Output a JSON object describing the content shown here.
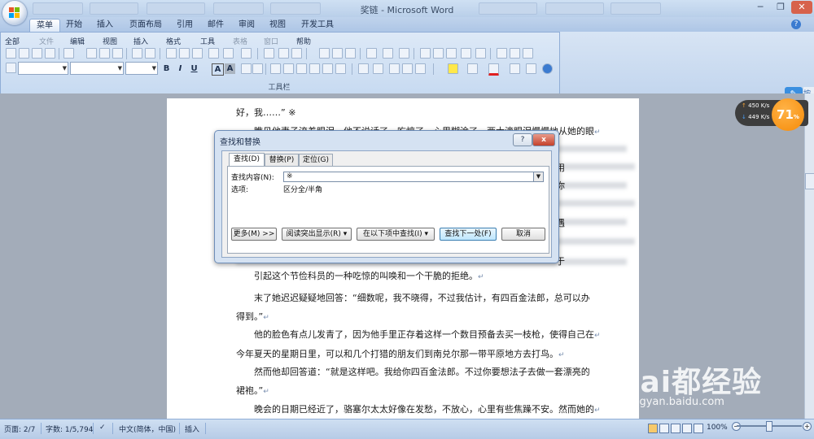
{
  "window": {
    "title": "奖链 - Microsoft Word",
    "background_tabs": [
      "",
      "",
      "",
      "",
      ""
    ]
  },
  "ribbon": {
    "tabs": [
      "菜单",
      "开始",
      "插入",
      "页面布局",
      "引用",
      "邮件",
      "审阅",
      "视图",
      "开发工具"
    ],
    "active_tab": "菜单",
    "menu_items": [
      "全部",
      "文件",
      "编辑",
      "视图",
      "插入",
      "格式",
      "工具",
      "表格",
      "窗口",
      "帮助"
    ],
    "disabled_menu_items": [
      "文件",
      "表格",
      "窗口"
    ],
    "toolbar_label": "工具栏",
    "format_buttons": [
      "B",
      "I",
      "U",
      "A",
      "A"
    ]
  },
  "document": {
    "lines": [
      {
        "indent": 85,
        "text": "好，我……” ※",
        "mark": ""
      },
      {
        "indent": 107,
        "text": "瞧见他妻子流着眼泪，他不说话了，吃惊了，心里糊涂了。两大滴眼泪慢慢地从她的眼",
        "mark": "↵"
      },
      {
        "indent": 107,
        "text": "引起这个节俭科员的一种吃惊的叫唤和一个干脆的拒绝。",
        "mark": "↵"
      },
      {
        "indent": 107,
        "text": "末了她迟迟疑疑地回答：“细数呢，我不晓得，不过我估计，有四百金法郎，总可以办",
        "mark": ""
      },
      {
        "indent": 85,
        "text": "得到。”",
        "mark": "↵"
      },
      {
        "indent": 107,
        "text": "他的脸色有点儿发青了，因为他手里正存着这样一个数目预备去买一枝枪，使得自己在",
        "mark": "↵"
      },
      {
        "indent": 85,
        "text": "今年夏天的星期日里，可以和几个打猎的朋友们到南兑尔那一带平原地方去打鸟。",
        "mark": "↵"
      },
      {
        "indent": 107,
        "text": "然而他却回答道：“就是这样吧。我给你四百金法郎。不过你要想法子去做一套漂亮的",
        "mark": ""
      },
      {
        "indent": 85,
        "text": "裙袍。”",
        "mark": "↵"
      },
      {
        "indent": 107,
        "text": "晚会的日期已经近了，骆塞尔太太好像在发愁，不放心，心里有些焦躁不安。然而她的",
        "mark": "↵"
      }
    ],
    "right_edge_fragments": [
      "用",
      "你",
      "遇",
      "于"
    ]
  },
  "dialog": {
    "title": "查找和替换",
    "help": "?",
    "close": "x",
    "tabs": [
      "查找(D)",
      "替换(P)",
      "定位(G)"
    ],
    "active_tab": "查找(D)",
    "find_label": "查找内容(N):",
    "find_value": "※",
    "options_label": "选项:",
    "options_value": "区分全/半角",
    "buttons": {
      "more": "更多(M) >>",
      "highlight": "阅读突出显示(R) ▾",
      "find_in": "在以下项中查找(I) ▾",
      "find_next": "查找下一处(F)",
      "cancel": "取消"
    }
  },
  "status": {
    "page": "页面: 2/7",
    "words": "字数: 1/5,794",
    "language": "中文(简体，中国)",
    "mode": "插入",
    "zoom": "100%",
    "zoom_percent": 100
  },
  "net_widget": {
    "upload": "450 K/s",
    "download": "449 K/s",
    "cpu": "71",
    "cpu_unit": "%"
  },
  "watermark": {
    "logo_text": "Bai都经验",
    "url": "jingyan.baidu.com"
  },
  "colors": {
    "accent": "#3a8fe0",
    "cpu_ball": "#f58a07",
    "dialog_bg": "#d5e2f2"
  }
}
